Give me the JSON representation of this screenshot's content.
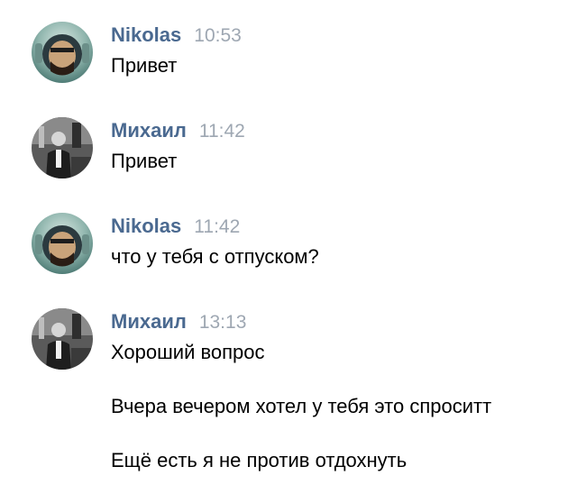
{
  "messages": [
    {
      "author": "Nikolas",
      "time": "10:53",
      "lines": [
        "Привет"
      ]
    },
    {
      "author": "Михаил",
      "time": "11:42",
      "lines": [
        "Привет"
      ]
    },
    {
      "author": "Nikolas",
      "time": "11:42",
      "lines": [
        "что у тебя с отпуском?"
      ]
    },
    {
      "author": "Михаил",
      "time": "13:13",
      "lines": [
        "Хороший вопрос",
        "Вчера вечером хотел у тебя это спроситт",
        "Ещё есть я не против отдохнуть"
      ]
    }
  ],
  "colors": {
    "author": "#4a6990",
    "time": "#9ea7b2",
    "text": "#000000"
  },
  "icons": {
    "nikolas_avatar": "astronaut-helmet-avatar",
    "mikhail_avatar": "bw-photo-avatar"
  }
}
